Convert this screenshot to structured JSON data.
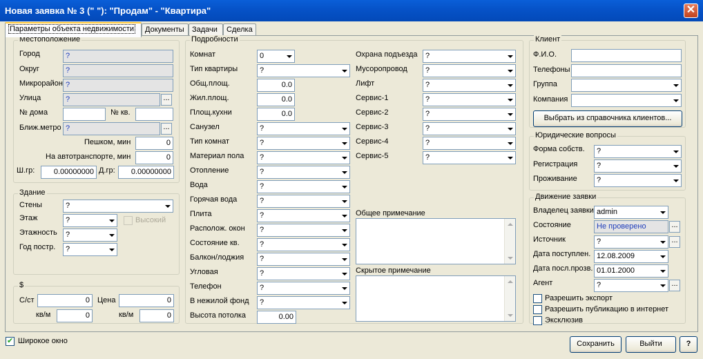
{
  "window": {
    "title": "Новая заявка № 3 (\" \"): \"Продам\" - \"Квартира\"",
    "close": "✕"
  },
  "tabs": [
    "Параметры объекта недвижимости",
    "Документы",
    "Задачи",
    "Сделка"
  ],
  "location": {
    "title": "Местоположение",
    "city": "Город",
    "city_val": "?",
    "district": "Округ",
    "district_val": "?",
    "microdistrict": "Микрорайон",
    "micro_val": "?",
    "street": "Улица",
    "street_val": "?",
    "house": "№ дома",
    "house_val": "",
    "apt": "№ кв.",
    "apt_val": "",
    "metro": "Ближ.метро",
    "metro_val": "?",
    "walk": "Пешком, мин",
    "walk_val": "0",
    "transport": "На автотранспорте, мин",
    "transport_val": "0",
    "lat": "Ш.гр:",
    "lat_val": "0.00000000",
    "lon": "Д.гр:",
    "lon_val": "0.00000000",
    "ellipsis": "..."
  },
  "building": {
    "title": "Здание",
    "walls": "Стены",
    "walls_val": "?",
    "floor": "Этаж",
    "floor_val": "?",
    "high": "Высокий",
    "floors": "Этажность",
    "floors_val": "?",
    "year": "Год постр.",
    "year_val": "?"
  },
  "price": {
    "title": "$",
    "cost": "С/ст",
    "cost_val": "0",
    "price": "Цена",
    "price_val": "0",
    "sqm1": "кв/м",
    "sqm1_val": "0",
    "sqm2": "кв/м",
    "sqm2_val": "0"
  },
  "details": {
    "title": "Подробности",
    "left": [
      {
        "label": "Комнат",
        "value": "0"
      },
      {
        "label": "Тип квартиры",
        "value": "?"
      },
      {
        "label": "Общ.площ.",
        "value": "0.0"
      },
      {
        "label": "Жил.площ.",
        "value": "0.0"
      },
      {
        "label": "Площ.кухни",
        "value": "0.0"
      },
      {
        "label": "Санузел",
        "value": "?"
      },
      {
        "label": "Тип комнат",
        "value": "?"
      },
      {
        "label": "Материал пола",
        "value": "?"
      },
      {
        "label": "Отопление",
        "value": "?"
      },
      {
        "label": "Вода",
        "value": "?"
      },
      {
        "label": "Горячая вода",
        "value": "?"
      },
      {
        "label": "Плита",
        "value": "?"
      },
      {
        "label": "Располож. окон",
        "value": "?"
      },
      {
        "label": "Состояние кв.",
        "value": "?"
      },
      {
        "label": "Балкон/лоджия",
        "value": "?"
      },
      {
        "label": "Угловая",
        "value": "?"
      },
      {
        "label": "Телефон",
        "value": "?"
      },
      {
        "label": "В нежилой фонд",
        "value": "?"
      },
      {
        "label": "Высота потолка",
        "value": "0.00"
      }
    ],
    "right": [
      {
        "label": "Охрана подъезда",
        "value": "?"
      },
      {
        "label": "Мусоропровод",
        "value": "?"
      },
      {
        "label": "Лифт",
        "value": "?"
      },
      {
        "label": "Сервис-1",
        "value": "?"
      },
      {
        "label": "Сервис-2",
        "value": "?"
      },
      {
        "label": "Сервис-3",
        "value": "?"
      },
      {
        "label": "Сервис-4",
        "value": "?"
      },
      {
        "label": "Сервис-5",
        "value": "?"
      }
    ],
    "general_note": "Общее примечание",
    "hidden_note": "Скрытое примечание"
  },
  "client": {
    "title": "Клиент",
    "name": "Ф.И.О.",
    "phones": "Телефоны",
    "group": "Группа",
    "company": "Компания",
    "select_btn": "Выбрать из справочника клиентов..."
  },
  "legal": {
    "title": "Юридические вопросы",
    "ownership": "Форма собств.",
    "ownership_val": "?",
    "registration": "Регистрация",
    "registration_val": "?",
    "residence": "Проживание",
    "residence_val": "?"
  },
  "flow": {
    "title": "Движение заявки",
    "owner": "Владелец заявки",
    "owner_val": "admin",
    "state": "Состояние",
    "state_val": "Не проверено",
    "source": "Источник",
    "source_val": "?",
    "date_in": "Дата поступлен.",
    "date_in_val": "12.08.2009",
    "date_last": "Дата посл.прозв.",
    "date_last_val": "01.01.2000",
    "agent": "Агент",
    "agent_val": "?",
    "export": "Разрешить экспорт",
    "publish": "Разрешить публикацию в интернет",
    "exclusive": "Эксклюзив"
  },
  "footer": {
    "wide": "Широкое окно",
    "save": "Сохранить",
    "exit": "Выйти",
    "help": "?"
  }
}
